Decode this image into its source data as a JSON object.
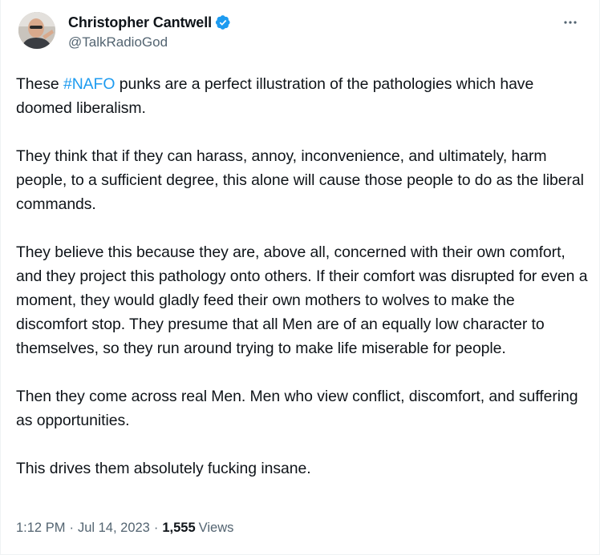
{
  "author": {
    "display_name": "Christopher Cantwell",
    "handle": "@TalkRadioGod",
    "verified_icon": "verified-badge-icon",
    "avatar_icon": "avatar"
  },
  "tweet": {
    "p1_before": "These ",
    "p1_hashtag": "#NAFO",
    "p1_after": " punks are a perfect illustration of the pathologies which have doomed liberalism.",
    "p2": "They think that if they can harass, annoy, inconvenience, and ultimately, harm people, to a sufficient degree, this alone will cause those people to do as the liberal commands.",
    "p3": "They believe this because they are, above all, concerned with their own comfort, and they project this pathology onto others. If their comfort was disrupted for even a moment, they would gladly feed their own mothers to wolves to make the discomfort stop. They presume that all Men are of an equally low character to themselves, so they run around trying to make life miserable for people.",
    "p4": "Then they come across real Men. Men who view conflict, discomfort, and suffering as opportunities.",
    "p5": "This drives them absolutely fucking insane."
  },
  "meta": {
    "time": "1:12 PM",
    "date": "Jul 14, 2023",
    "separator": "·",
    "views_count": "1,555",
    "views_label": "Views"
  },
  "colors": {
    "link": "#1d9bf0",
    "text": "#0f1419",
    "secondary": "#536471"
  },
  "more_icon": "more-horizontal-icon"
}
